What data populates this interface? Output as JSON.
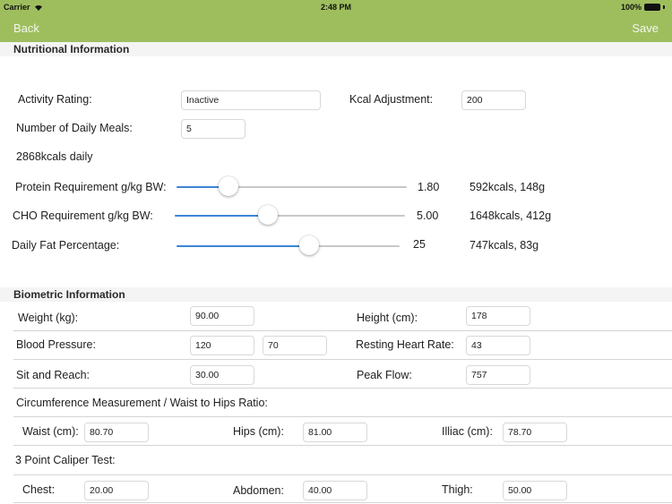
{
  "status_bar": {
    "carrier": "Carrier",
    "time": "2:48 PM",
    "battery": "100%"
  },
  "nav": {
    "back_label": "Back",
    "save_label": "Save",
    "bar_color": "#9ebe5e"
  },
  "nutrition": {
    "section_title": "Nutritional Information",
    "activity_rating": {
      "label": "Activity Rating:",
      "value": "Inactive"
    },
    "kcal_adjustment": {
      "label": "Kcal Adjustment:",
      "value": "200"
    },
    "daily_meals": {
      "label": "Number of Daily Meals:",
      "value": "5"
    },
    "daily_total": "2868kcals daily",
    "sliders": [
      {
        "label": "Protein Requirement g/kg BW:",
        "value_text": "1.80",
        "summary": "592kcals, 148g",
        "fraction": 0.226
      },
      {
        "label": "CHO Requirement g/kg BW:",
        "value_text": "5.00",
        "summary": "1648kcals, 412g",
        "fraction": 0.405
      },
      {
        "label": "Daily Fat Percentage:",
        "value_text": "25",
        "summary": "747kcals, 83g",
        "fraction": 0.594
      }
    ],
    "slider_accent": "#3b86d6"
  },
  "biometric": {
    "section_title": "Biometric Information",
    "weight": {
      "label": "Weight (kg):",
      "value": "90.00"
    },
    "height": {
      "label": "Height (cm):",
      "value": "178"
    },
    "blood_pressure": {
      "label": "Blood Pressure:",
      "systolic": "120",
      "diastolic": "70"
    },
    "resting_heart_rate": {
      "label": "Resting Heart Rate:",
      "value": "43"
    },
    "sit_and_reach": {
      "label": "Sit and Reach:",
      "value": "30.00"
    },
    "peak_flow": {
      "label": "Peak Flow:",
      "value": "757"
    },
    "circumference_title": "Circumference Measurement / Waist to Hips Ratio:",
    "waist": {
      "label": "Waist (cm):",
      "value": "80.70"
    },
    "hips": {
      "label": "Hips (cm):",
      "value": "81.00"
    },
    "illiac": {
      "label": "Illiac (cm):",
      "value": "78.70"
    },
    "caliper_title": "3 Point Caliper Test:",
    "chest": {
      "label": "Chest:",
      "value": "20.00"
    },
    "abdomen": {
      "label": "Abdomen:",
      "value": "40.00"
    },
    "thigh": {
      "label": "Thigh:",
      "value": "50.00"
    }
  }
}
